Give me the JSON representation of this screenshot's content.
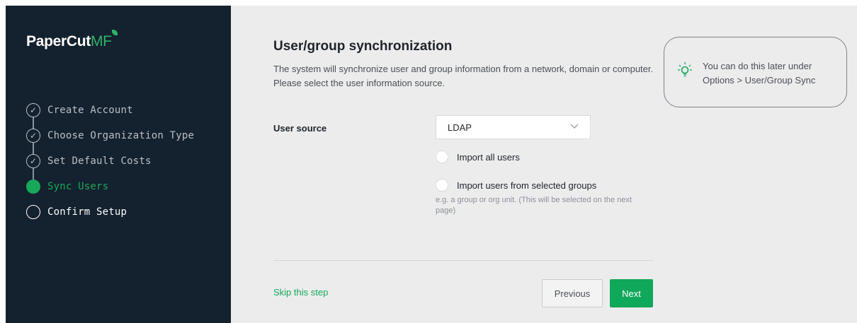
{
  "brand": {
    "name_main": "PaperCut",
    "name_accent": "MF"
  },
  "steps": [
    {
      "label": "Create Account",
      "state": "done"
    },
    {
      "label": "Choose Organization Type",
      "state": "done"
    },
    {
      "label": "Set Default Costs",
      "state": "done"
    },
    {
      "label": "Sync Users",
      "state": "active"
    },
    {
      "label": "Confirm Setup",
      "state": "pending"
    }
  ],
  "page": {
    "title": "User/group synchronization",
    "description": "The system will synchronize user and group information from a network, domain or computer. Please select the user information source."
  },
  "form": {
    "user_source_label": "User source",
    "user_source_value": "LDAP",
    "radio_all": "Import all users",
    "radio_groups": "Import users from selected groups",
    "radio_groups_hint": "e.g. a group or org unit. (This will be selected on the next page)"
  },
  "footer": {
    "skip_label": "Skip this step",
    "previous_label": "Previous",
    "next_label": "Next"
  },
  "tip": {
    "text": "You can do this later under Options > User/Group Sync"
  },
  "colors": {
    "accent": "#17a85a",
    "sidebar_bg": "#14212e",
    "page_bg": "#ececed"
  }
}
